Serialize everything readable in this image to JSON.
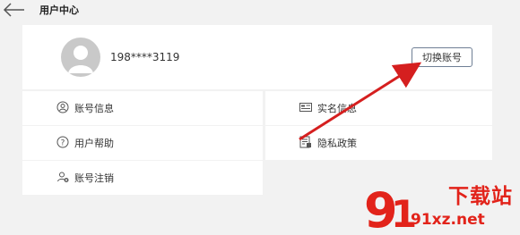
{
  "header": {
    "title": "用户中心"
  },
  "profile": {
    "phone": "198****3119",
    "switch_label": "切换账号"
  },
  "menu": {
    "items": [
      {
        "label": "账号信息",
        "icon": "user-circle-icon"
      },
      {
        "label": "实名信息",
        "icon": "id-card-icon"
      },
      {
        "label": "用户帮助",
        "icon": "question-circle-icon"
      },
      {
        "label": "隐私政策",
        "icon": "privacy-doc-icon"
      },
      {
        "label": "账号注销",
        "icon": "user-cancel-icon"
      }
    ]
  },
  "watermark": {
    "brand": "下载站",
    "domain": "91xz.net",
    "logo": "91"
  },
  "colors": {
    "accent": "#e2231a",
    "background": "#f2f2f2",
    "card": "#ffffff"
  }
}
